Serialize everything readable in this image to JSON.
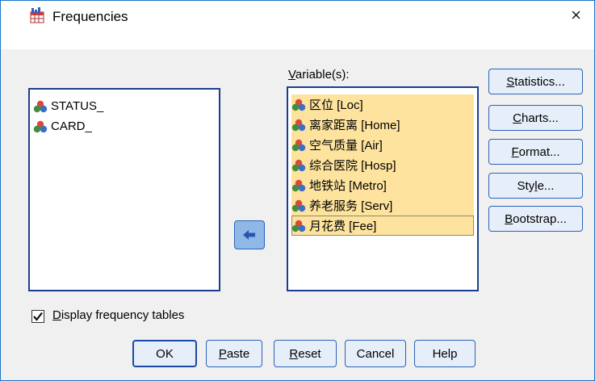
{
  "window": {
    "title": "Frequencies",
    "close_glyph": "×"
  },
  "source_list": {
    "items": [
      "STATUS_",
      "CARD_"
    ]
  },
  "variables_label": {
    "prefix": "V",
    "rest": "ariable(s):"
  },
  "selected_list": {
    "items": [
      "区位 [Loc]",
      "离家距离 [Home]",
      "空气质量 [Air]",
      "综合医院 [Hosp]",
      "地铁站 [Metro]",
      "养老服务 [Serv]",
      "月花费 [Fee]"
    ],
    "focused_index": 6
  },
  "side_buttons": {
    "statistics": {
      "u": "S",
      "rest": "tatistics..."
    },
    "charts": {
      "u": "C",
      "rest": "harts..."
    },
    "format": {
      "u": "F",
      "rest": "ormat..."
    },
    "style": {
      "pre": "Sty",
      "u": "l",
      "rest": "e..."
    },
    "bootstrap": {
      "u": "B",
      "rest": "ootstrap..."
    }
  },
  "checkbox": {
    "u": "D",
    "rest": "isplay frequency tables",
    "checked": true
  },
  "bottom_buttons": {
    "ok": "OK",
    "paste": {
      "u": "P",
      "rest": "aste"
    },
    "reset": {
      "u": "R",
      "rest": "eset"
    },
    "cancel": "Cancel",
    "help": "Help"
  },
  "colors": {
    "selection_bg": "#fde39d",
    "listbox_border": "#1b3f8e",
    "button_bg": "#e6eff9",
    "button_border": "#2a62b9",
    "client_bg": "#f0f0f0"
  },
  "icons": {
    "app": "frequencies-table-icon",
    "variable": "nominal-variable-icon",
    "move": "move-left-arrow-icon",
    "close": "close-icon"
  }
}
